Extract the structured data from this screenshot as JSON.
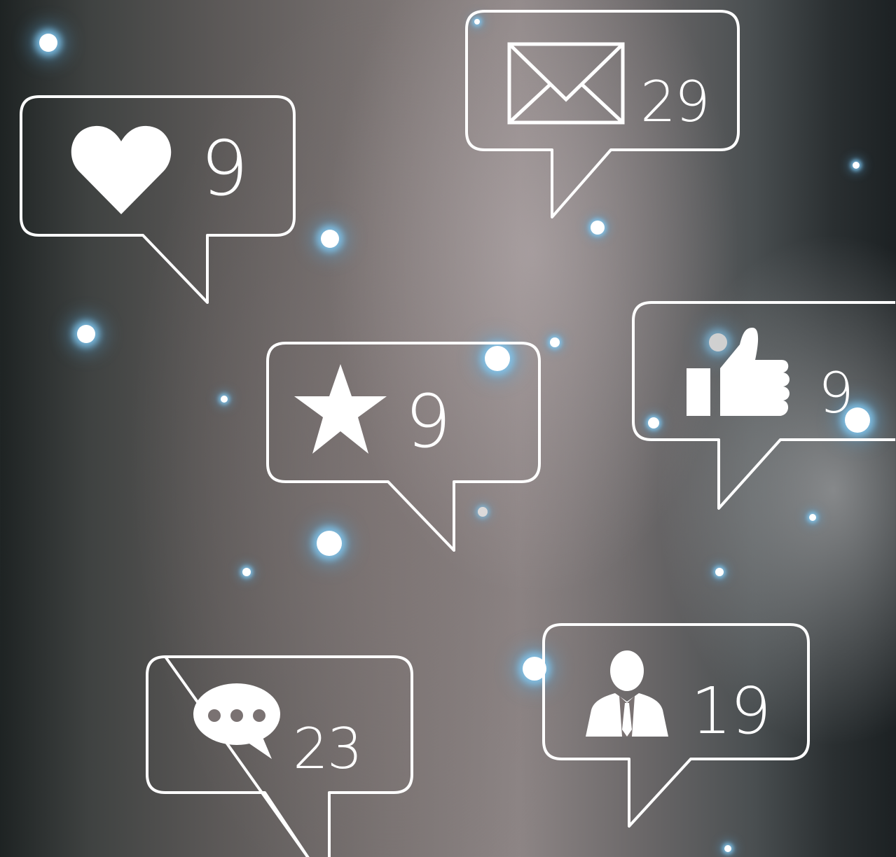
{
  "badges": {
    "heart": {
      "icon": "heart-icon",
      "count": "9"
    },
    "mail": {
      "icon": "envelope-icon",
      "count": "29"
    },
    "star": {
      "icon": "star-icon",
      "count": "9"
    },
    "like": {
      "icon": "thumbs-up-icon",
      "count": "9"
    },
    "comment": {
      "icon": "chat-bubble-icon",
      "count": "23"
    },
    "follower": {
      "icon": "person-icon",
      "count": "19"
    }
  },
  "colors": {
    "outline": "#ffffff",
    "glow": "#82c8f0"
  }
}
